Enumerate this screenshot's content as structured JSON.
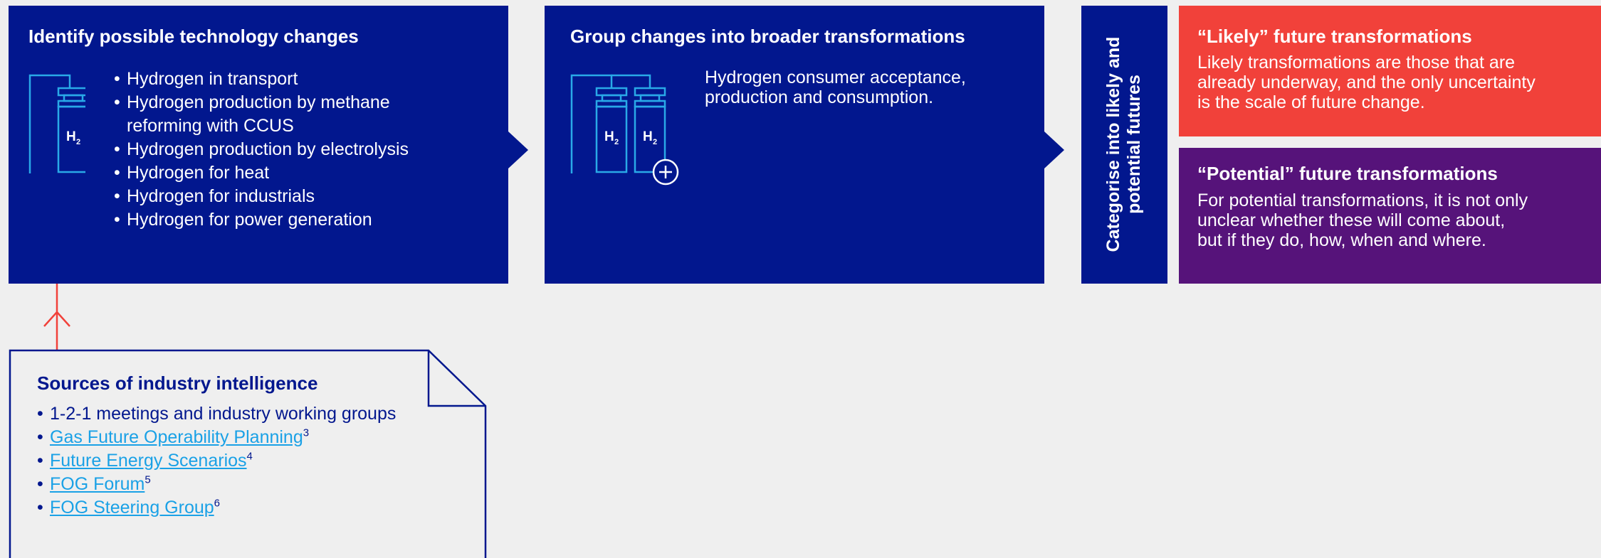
{
  "step1": {
    "title": "Identify possible technology changes",
    "icon_label": "H",
    "icon_sub": "2",
    "items": [
      "Hydrogen in transport",
      "Hydrogen production by methane",
      "reforming with CCUS",
      "Hydrogen production by electrolysis",
      "Hydrogen for heat",
      "Hydrogen for industrials",
      "Hydrogen for power generation"
    ]
  },
  "step2": {
    "title": "Group changes into broader transformations",
    "icon_label": "H",
    "icon_sub": "2",
    "text_line1": "Hydrogen consumer acceptance,",
    "text_line2": "production and consumption."
  },
  "step3": {
    "line1": "Categorise into likely and",
    "line2": "potential futures"
  },
  "likely": {
    "title": "“Likely” future transformations",
    "line1": "Likely transformations are those that are",
    "line2": "already underway, and the only uncertainty",
    "line3": "is the scale of future change.",
    "color": "#f1413a"
  },
  "potential": {
    "title": "“Potential” future transformations",
    "line1": "For potential transformations, it is not only",
    "line2": "unclear whether these will come about,",
    "line3": "but if they do, how, when and where.",
    "color": "#56137a"
  },
  "sources": {
    "title": "Sources of industry intelligence",
    "items": [
      {
        "text": "1-2-1 meetings and industry working groups",
        "sup": ""
      },
      {
        "text": "Gas Future Operability Planning",
        "sup": "3"
      },
      {
        "text": "Future Energy Scenarios",
        "sup": "4"
      },
      {
        "text": "FOG Forum",
        "sup": "5"
      },
      {
        "text": "FOG Steering Group",
        "sup": "6"
      }
    ]
  },
  "colors": {
    "navy": "#02178e",
    "accent_red": "#f1413a",
    "link_blue": "#1aa1e6",
    "icon_blue": "#29a9e8"
  }
}
